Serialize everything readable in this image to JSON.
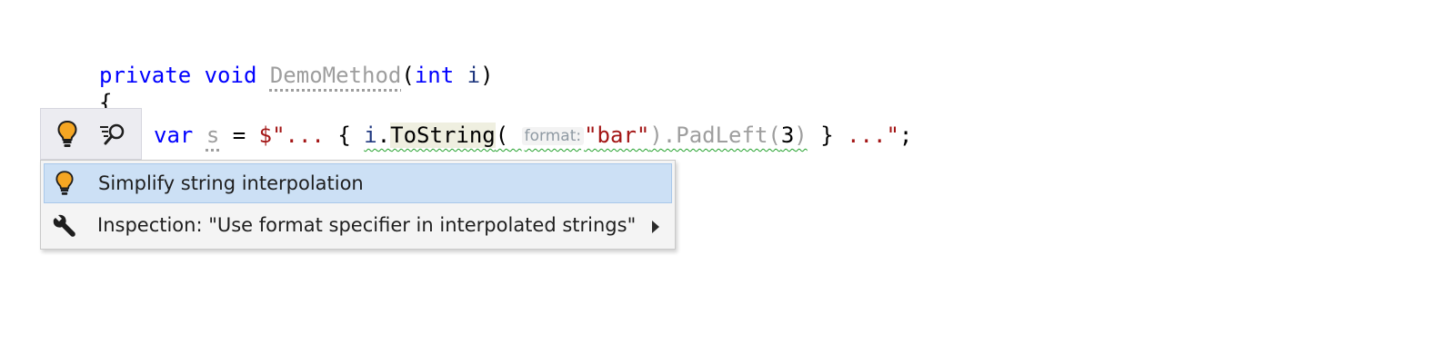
{
  "editor": {
    "line1": {
      "kw_private": "private",
      "kw_void": "void",
      "method_name": "DemoMethod",
      "open_paren": "(",
      "kw_int": "int",
      "param": "i",
      "close_paren": ")"
    },
    "line2": {
      "brace": "{"
    },
    "line3": {
      "kw_var": "var",
      "var_name": "s",
      "assign": " = ",
      "str_start": "$\"...",
      "brace_open": " { ",
      "param": "i",
      "dot1": ".",
      "method_tostring": "ToString",
      "open_paren": "(",
      "hint_format": "format:",
      "str_bar": "\"bar\"",
      "close_paren": ")",
      "method_padleft": ".PadLeft(",
      "num": "3",
      "close_paren2": ")",
      "brace_close": " } ",
      "str_end": "...\"",
      "semicolon": ";"
    }
  },
  "bulb_bar": {
    "icons": [
      "lightbulb-icon",
      "inspect-search-icon"
    ]
  },
  "menu": {
    "items": [
      {
        "label": "Simplify string interpolation",
        "icon": "lightbulb-icon",
        "selected": true
      },
      {
        "label": "Inspection: \"Use format specifier in interpolated strings\"",
        "icon": "wrench-icon",
        "has_submenu": true
      }
    ]
  },
  "colors": {
    "keyword": "#0000ff",
    "string": "#a31515",
    "unused": "#9e9e9e",
    "selection": "#cce0f5",
    "squiggle": "#22a12b"
  }
}
